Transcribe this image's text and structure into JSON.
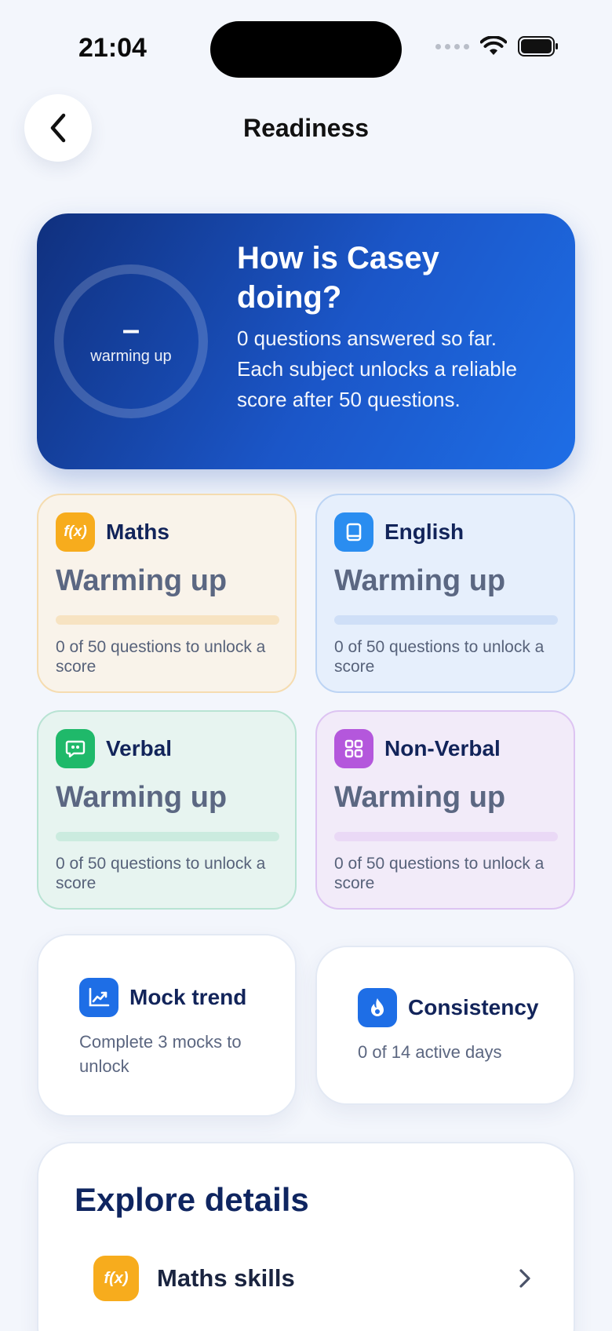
{
  "status_bar": {
    "time": "21:04"
  },
  "header": {
    "title": "Readiness"
  },
  "hero": {
    "ring_value": "–",
    "ring_label": "warming up",
    "title": "How is Casey doing?",
    "description": "0 questions answered so far. Each subject unlocks a reliable score after 50 questions."
  },
  "subjects": [
    {
      "icon": "f(x)",
      "name": "Maths",
      "status": "Warming up",
      "progress": 0,
      "note": "0 of 50 questions to unlock a score"
    },
    {
      "icon": "book-icon",
      "name": "English",
      "status": "Warming up",
      "progress": 0,
      "note": "0 of 50 questions to unlock a score"
    },
    {
      "icon": "speech-bubble-icon",
      "name": "Verbal",
      "status": "Warming up",
      "progress": 0,
      "note": "0 of 50 questions to unlock a score"
    },
    {
      "icon": "grid-icon",
      "name": "Non-Verbal",
      "status": "Warming up",
      "progress": 0,
      "note": "0 of 50 questions to unlock a score"
    }
  ],
  "mock_trend": {
    "title": "Mock trend",
    "text": "Complete 3 mocks to unlock"
  },
  "consistency": {
    "title": "Consistency",
    "text": "0 of 14 active days"
  },
  "explore": {
    "title": "Explore details",
    "items": [
      {
        "icon": "f(x)",
        "label": "Maths skills"
      }
    ]
  },
  "colors": {
    "hero_start": "#10307e",
    "hero_end": "#1e6ee6",
    "maths": "#f7ac1d",
    "english": "#2a8df0",
    "verbal": "#1fb96a",
    "non_verbal": "#b457dc"
  }
}
